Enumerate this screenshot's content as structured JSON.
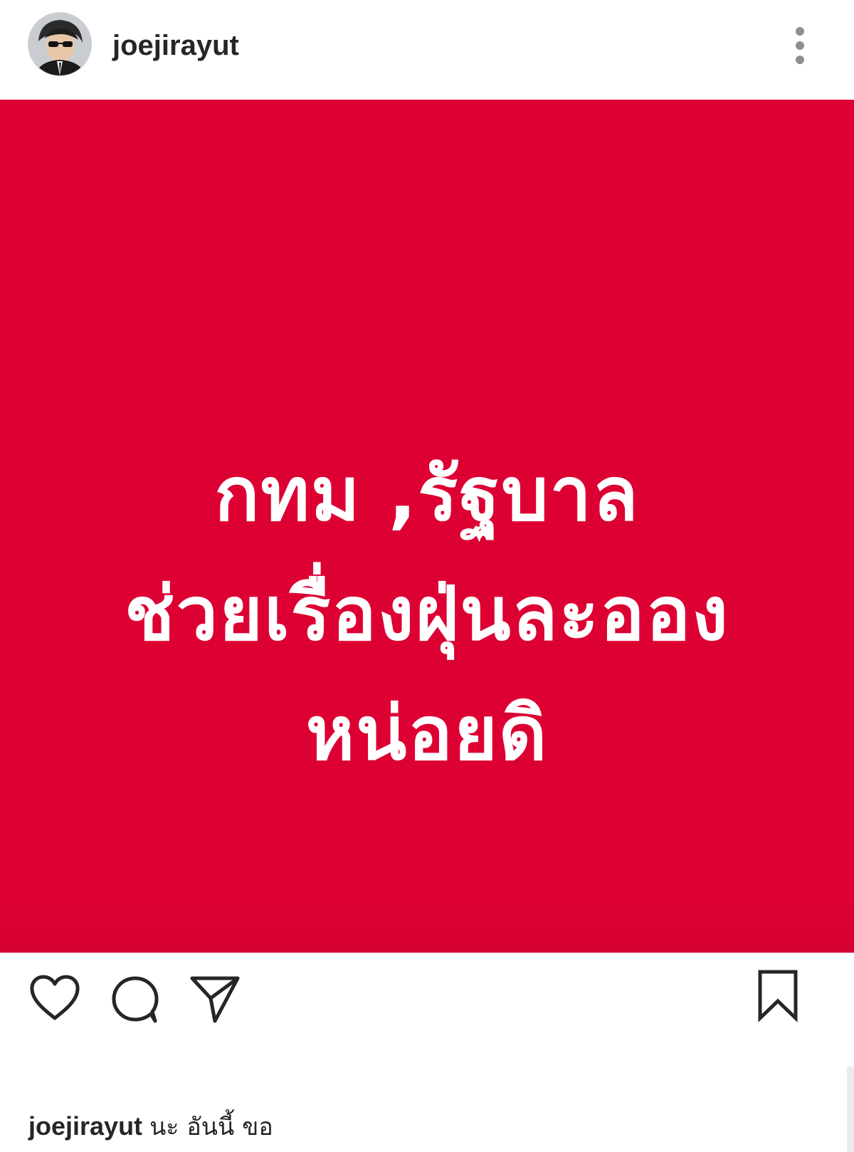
{
  "post": {
    "username": "joejirayut",
    "avatar": "profile-photo",
    "image": {
      "background_color": "#dc0033",
      "text_color": "#ffffff",
      "lines": [
        "กทม ,รัฐบาล",
        "ช่วยเรื่องฝุ่นละออง",
        "หน่อยดิ"
      ]
    },
    "actions": {
      "like_icon": "heart-icon",
      "comment_icon": "comment-icon",
      "share_icon": "send-icon",
      "save_icon": "bookmark-icon"
    },
    "caption": {
      "username": "joejirayut",
      "text": "นะ อันนี้ ขอ"
    }
  },
  "menu_icon": "more-options-icon"
}
